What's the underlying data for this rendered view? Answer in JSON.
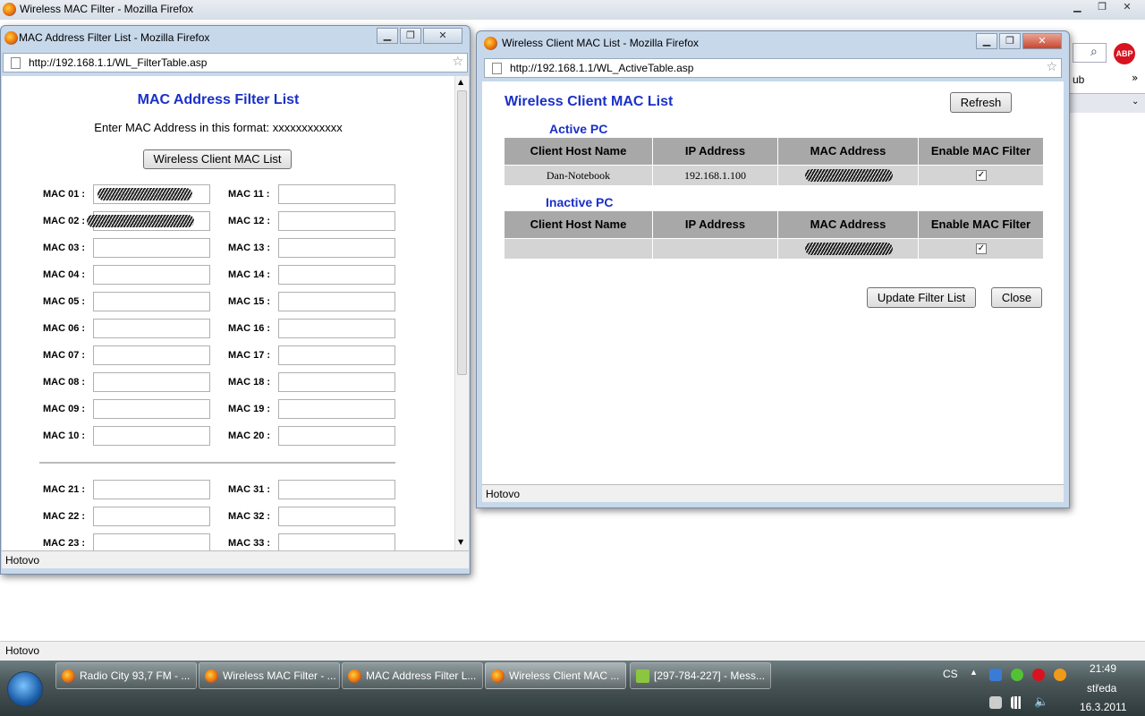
{
  "main_window": {
    "title": "Wireless MAC Filter - Mozilla Firefox",
    "status": "Hotovo",
    "toolbar_fragment": "ub",
    "adblock_label": "ABP"
  },
  "filter_window": {
    "title": "MAC Address Filter List - Mozilla Firefox",
    "url": "http://192.168.1.1/WL_FilterTable.asp",
    "heading": "MAC Address Filter List",
    "format_text": "Enter MAC Address in this format: xxxxxxxxxxxx",
    "client_list_button": "Wireless Client MAC List",
    "status": "Hotovo",
    "mac_labels_left": [
      "MAC 01 :",
      "MAC 02 :",
      "MAC 03 :",
      "MAC 04 :",
      "MAC 05 :",
      "MAC 06 :",
      "MAC 07 :",
      "MAC 08 :",
      "MAC 09 :",
      "MAC 10 :"
    ],
    "mac_labels_right": [
      "MAC 11 :",
      "MAC 12 :",
      "MAC 13 :",
      "MAC 14 :",
      "MAC 15 :",
      "MAC 16 :",
      "MAC 17 :",
      "MAC 18 :",
      "MAC 19 :",
      "MAC 20 :"
    ],
    "mac_labels_left_2": [
      "MAC 21 :",
      "MAC 22 :",
      "MAC 23 :"
    ],
    "mac_labels_right_2": [
      "MAC 31 :",
      "MAC 32 :",
      "MAC 33 :"
    ]
  },
  "client_window": {
    "title": "Wireless Client MAC List - Mozilla Firefox",
    "url": "http://192.168.1.1/WL_ActiveTable.asp",
    "heading": "Wireless Client MAC List",
    "refresh_button": "Refresh",
    "active_section": "Active PC",
    "inactive_section": "Inactive PC",
    "columns": [
      "Client Host Name",
      "IP Address",
      "MAC Address",
      "Enable MAC Filter"
    ],
    "active_rows": [
      {
        "host": "Dan-Notebook",
        "ip": "192.168.1.100",
        "mac": "",
        "enabled": "✓"
      }
    ],
    "inactive_rows": [
      {
        "host": "",
        "ip": "",
        "mac": "",
        "enabled": "✓"
      }
    ],
    "update_button": "Update Filter List",
    "close_button": "Close",
    "status": "Hotovo"
  },
  "taskbar": {
    "buttons": [
      "Radio City 93,7 FM - ...",
      "Wireless MAC Filter - ...",
      "MAC Address Filter L...",
      "Wireless Client MAC ...",
      "[297-784-227] - Mess..."
    ],
    "language": "CS",
    "time": "21:49",
    "day": "středa",
    "date": "16.3.2011"
  }
}
